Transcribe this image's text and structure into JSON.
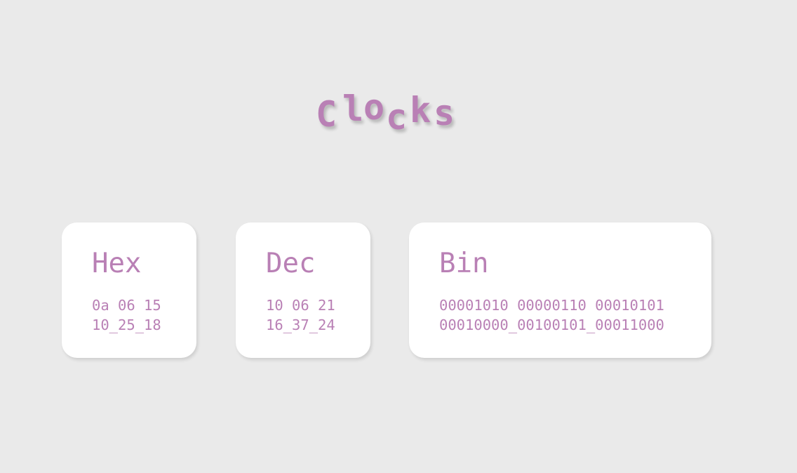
{
  "title": {
    "text": "Clocks",
    "letters": [
      "C",
      "l",
      "o",
      "c",
      "k",
      "s"
    ]
  },
  "cards": {
    "hex": {
      "heading": "Hex",
      "date": "0a 06 15",
      "time": "10_25_18"
    },
    "dec": {
      "heading": "Dec",
      "date": "10 06 21",
      "time": "16_37_24"
    },
    "bin": {
      "heading": "Bin",
      "date": "00001010 00000110 00010101",
      "time": "00010000_00100101_00011000"
    }
  },
  "colors": {
    "accent": "#b980b5",
    "background": "#eaeaea",
    "card": "#ffffff"
  }
}
